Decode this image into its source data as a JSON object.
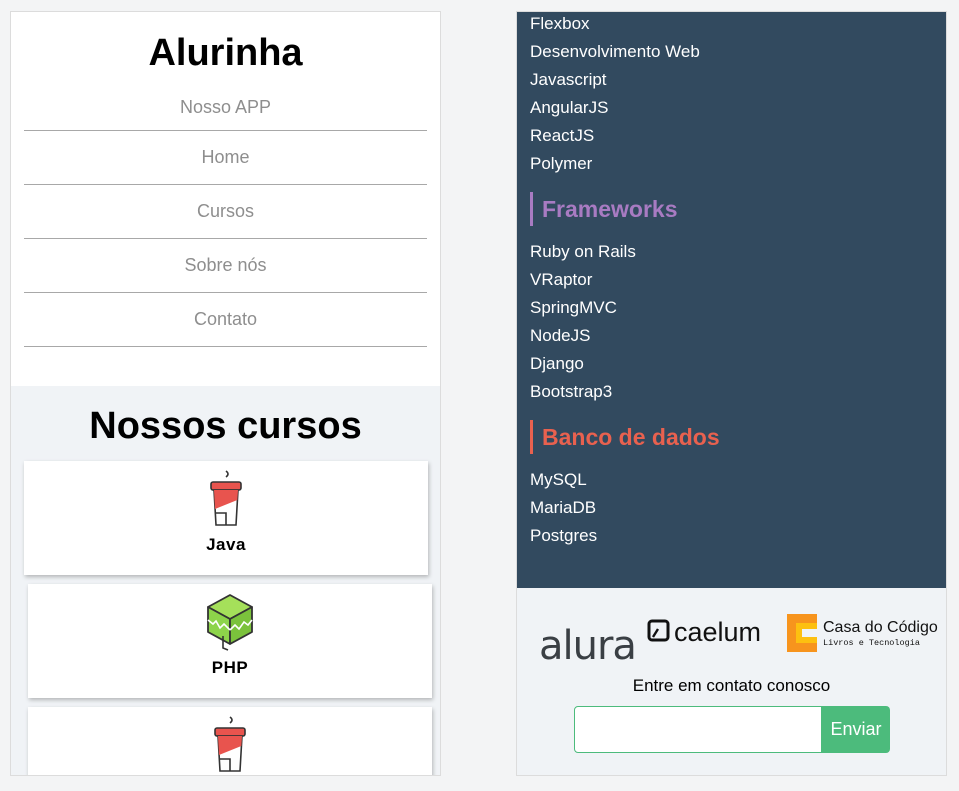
{
  "header": {
    "brand": "Alurinha"
  },
  "nav": {
    "items": [
      {
        "label": "Nosso APP"
      },
      {
        "label": "Home"
      },
      {
        "label": "Cursos"
      },
      {
        "label": "Sobre nós"
      },
      {
        "label": "Contato"
      }
    ]
  },
  "courses": {
    "title": "Nossos cursos",
    "items": [
      {
        "name": "Java",
        "icon": "coffee-cup-icon"
      },
      {
        "name": "PHP",
        "icon": "php-cube-icon"
      },
      {
        "name": "",
        "icon": "coffee-cup-icon"
      }
    ]
  },
  "topics": {
    "web_items": [
      "Flexbox",
      "Desenvolvimento Web",
      "Javascript",
      "AngularJS",
      "ReactJS",
      "Polymer"
    ],
    "frameworks": {
      "heading": "Frameworks",
      "color": "#a87bc2",
      "items": [
        "Ruby on Rails",
        "VRaptor",
        "SpringMVC",
        "NodeJS",
        "Django",
        "Bootstrap3"
      ]
    },
    "databases": {
      "heading": "Banco de dados",
      "color": "#e8614f",
      "items": [
        "MySQL",
        "MariaDB",
        "Postgres"
      ]
    }
  },
  "footer": {
    "logos": {
      "alura": "alura",
      "caelum": "caelum",
      "cdc_title": "Casa do Código",
      "cdc_subtitle": "Livros e Tecnologia"
    },
    "contact_label": "Entre em contato conosco",
    "email_placeholder": "",
    "send_label": "Enviar"
  },
  "colors": {
    "dark_panel": "#324a5f",
    "accent_green": "#4cbb7c",
    "cup_red": "#e8544e",
    "php_green": "#8dd44a"
  }
}
